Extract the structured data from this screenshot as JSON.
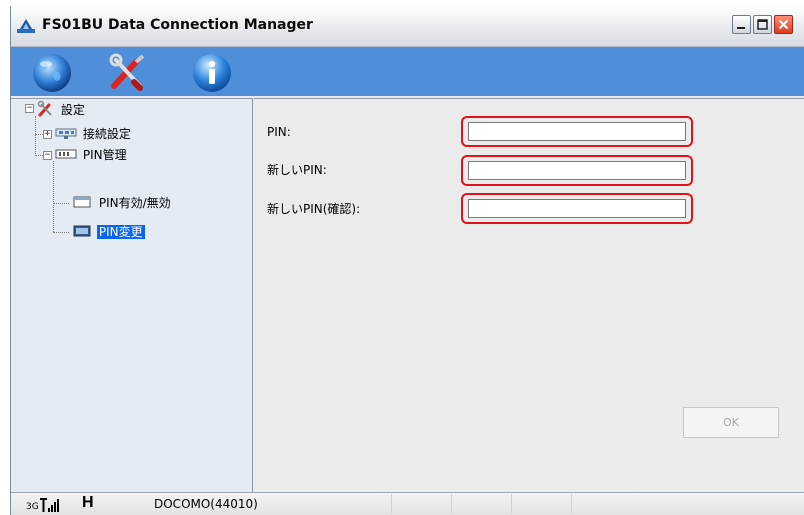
{
  "window": {
    "title": "FS01BU Data Connection Manager"
  },
  "toolbar": {
    "icons": [
      "globe-icon",
      "tools-icon",
      "info-icon"
    ]
  },
  "tree": {
    "root": "設定",
    "connection": "接続設定",
    "pin_mgmt": "PIN管理",
    "pin_toggle": "PIN有効/無効",
    "pin_change": "PIN変更"
  },
  "form": {
    "pin_label": "PIN:",
    "pin_value": "",
    "new_pin_label": "新しいPIN:",
    "new_pin_value": "",
    "confirm_label": "新しいPIN(確認):",
    "confirm_value": "",
    "highlight_color": "#e0131a"
  },
  "buttons": {
    "ok": "OK"
  },
  "status": {
    "net_gen": "3G",
    "net_type": "H",
    "carrier": "DOCOMO(44010)"
  },
  "colors": {
    "toolbar": "#4f8ed8",
    "selection": "#0a64f0"
  }
}
